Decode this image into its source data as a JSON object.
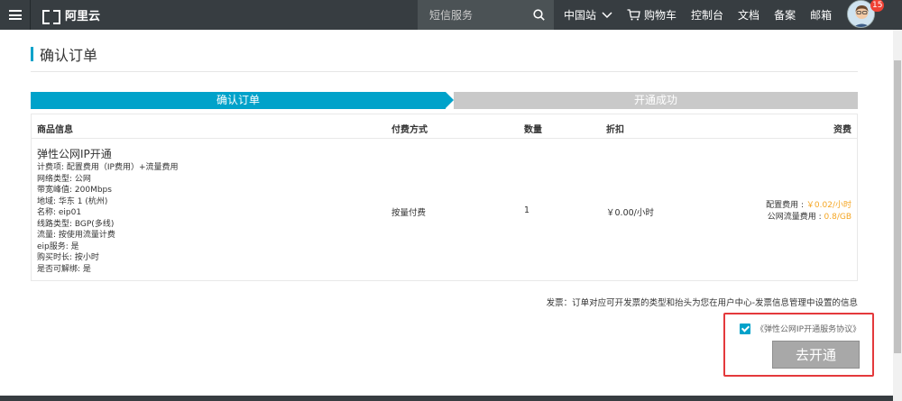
{
  "topbar": {
    "logo_text": "阿里云",
    "search_placeholder": "短信服务",
    "nav": {
      "region": "中国站",
      "cart": "购物车",
      "console": "控制台",
      "docs": "文档",
      "beian": "备案",
      "mail": "邮箱"
    },
    "notification_count": "15"
  },
  "page": {
    "title": "确认订单"
  },
  "steps": [
    {
      "label": "确认订单",
      "active": true
    },
    {
      "label": "开通成功",
      "active": false
    }
  ],
  "table": {
    "headers": {
      "product": "商品信息",
      "payment": "付费方式",
      "quantity": "数量",
      "discount": "折扣",
      "fee": "资费"
    },
    "row": {
      "product_name": "弹性公网IP开通",
      "details": [
        "计费项: 配置费用（IP费用）+流量费用",
        "网络类型: 公网",
        "带宽峰值: 200Mbps",
        "地域: 华东 1 (杭州)",
        "名称: eip01",
        "线路类型: BGP(多线)",
        "流量: 按使用流量计费",
        "eip服务: 是",
        "购买时长: 按小时",
        "是否可解绑: 是"
      ],
      "payment": "按量付费",
      "quantity": "1",
      "discount": "￥0.00/小时",
      "fee_config_label": "配置费用 : ",
      "fee_config_value": "￥0.02/小时",
      "fee_traffic_label": "公网流量费用 : ",
      "fee_traffic_value": "0.8/GB"
    }
  },
  "invoice_note": "发票：订单对应可开发票的类型和抬头为您在用户中心-发票信息管理中设置的信息",
  "agreement": {
    "checked": true,
    "label": "《弹性公网IP开通服务协议》"
  },
  "submit_label": "去开通",
  "colors": {
    "accent": "#00a2ca",
    "topbar": "#373d41",
    "price": "#f5a623",
    "highlight_border": "#e4393c"
  }
}
